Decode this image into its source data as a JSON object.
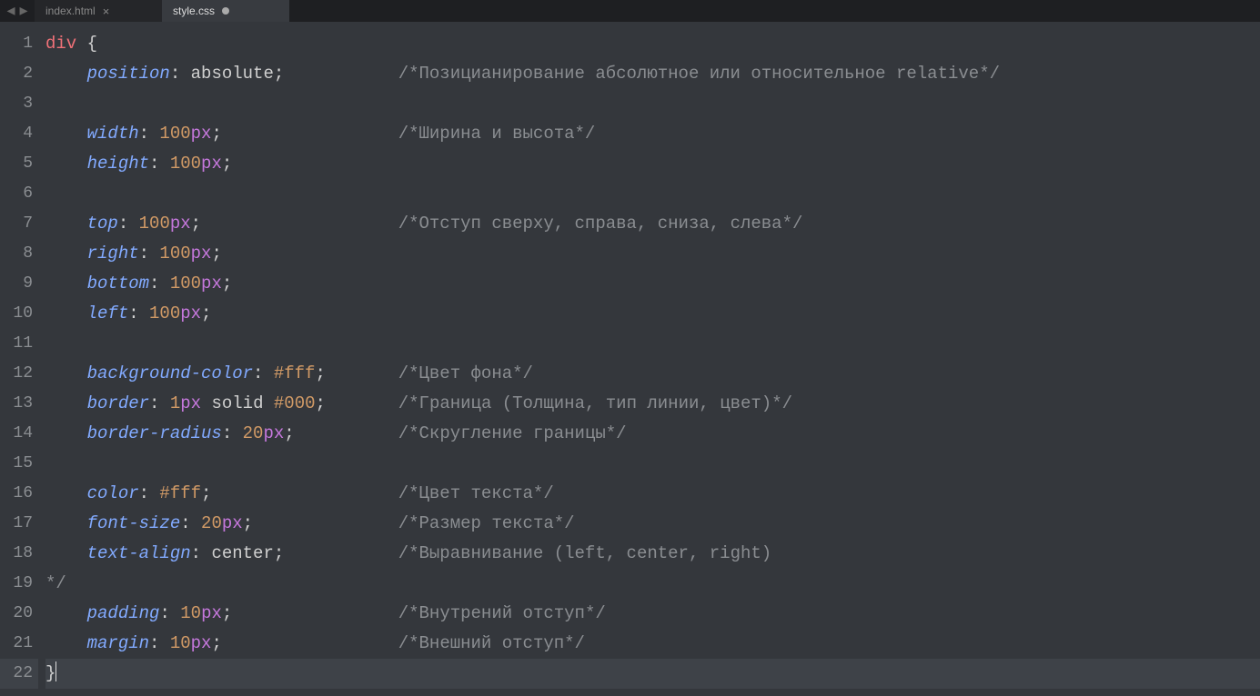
{
  "titlebar": {
    "navLeft": "◂",
    "navRight": "▸"
  },
  "tabs": [
    {
      "label": "index.html",
      "active": false,
      "dirty": false
    },
    {
      "label": "style.css",
      "active": true,
      "dirty": true
    }
  ],
  "close_glyph": "×",
  "lineNumbers": [
    "1",
    "2",
    "3",
    "4",
    "5",
    "6",
    "7",
    "8",
    "9",
    "10",
    "11",
    "12",
    "13",
    "14",
    "15",
    "16",
    "17",
    "18",
    "19",
    "20",
    "21",
    "22"
  ],
  "currentLine": 22,
  "code": {
    "l1": {
      "tag": "div",
      "brace": " {"
    },
    "l2": {
      "prop": "position",
      "colon": ":",
      "val": " absolute",
      "semi": ";",
      "comment": "/*Позицианирование абсолютное или относительное relative*/"
    },
    "l4": {
      "prop": "width",
      "colon": ":",
      "num": " 100",
      "unit": "px",
      "semi": ";",
      "comment": "/*Ширина и высота*/"
    },
    "l5": {
      "prop": "height",
      "colon": ":",
      "num": " 100",
      "unit": "px",
      "semi": ";"
    },
    "l7": {
      "prop": "top",
      "colon": ":",
      "num": " 100",
      "unit": "px",
      "semi": ";",
      "comment": "/*Отступ сверху, справа, сниза, слева*/"
    },
    "l8": {
      "prop": "right",
      "colon": ":",
      "num": " 100",
      "unit": "px",
      "semi": ";"
    },
    "l9": {
      "prop": "bottom",
      "colon": ":",
      "num": " 100",
      "unit": "px",
      "semi": ";"
    },
    "l10": {
      "prop": "left",
      "colon": ":",
      "num": " 100",
      "unit": "px",
      "semi": ";"
    },
    "l12": {
      "prop": "background-color",
      "colon": ":",
      "hex": " #fff",
      "semi": ";",
      "comment": "/*Цвет фона*/"
    },
    "l13": {
      "prop": "border",
      "colon": ":",
      "num": " 1",
      "unit": "px",
      "kw": " solid",
      "hex": " #000",
      "semi": ";",
      "comment": "/*Граница (Толщина, тип линии, цвет)*/"
    },
    "l14": {
      "prop": "border-radius",
      "colon": ":",
      "num": " 20",
      "unit": "px",
      "semi": ";",
      "comment": "/*Скругление границы*/"
    },
    "l16": {
      "prop": "color",
      "colon": ":",
      "hex": " #fff",
      "semi": ";",
      "comment": "/*Цвет текста*/"
    },
    "l17": {
      "prop": "font-size",
      "colon": ":",
      "num": " 20",
      "unit": "px",
      "semi": ";",
      "comment": "/*Размер текста*/"
    },
    "l18": {
      "prop": "text-align",
      "colon": ":",
      "val": " center",
      "semi": ";",
      "comment": "/*Выравнивание (left, center, right) "
    },
    "l19": {
      "comment": "*/"
    },
    "l20": {
      "prop": "padding",
      "colon": ":",
      "num": " 10",
      "unit": "px",
      "semi": ";",
      "comment": "/*Внутрений отступ*/"
    },
    "l21": {
      "prop": "margin",
      "colon": ":",
      "num": " 10",
      "unit": "px",
      "semi": ";",
      "comment": "/*Внешний отступ*/"
    },
    "l22": {
      "brace": "}"
    }
  },
  "indent": "    ",
  "commentCol": 34
}
